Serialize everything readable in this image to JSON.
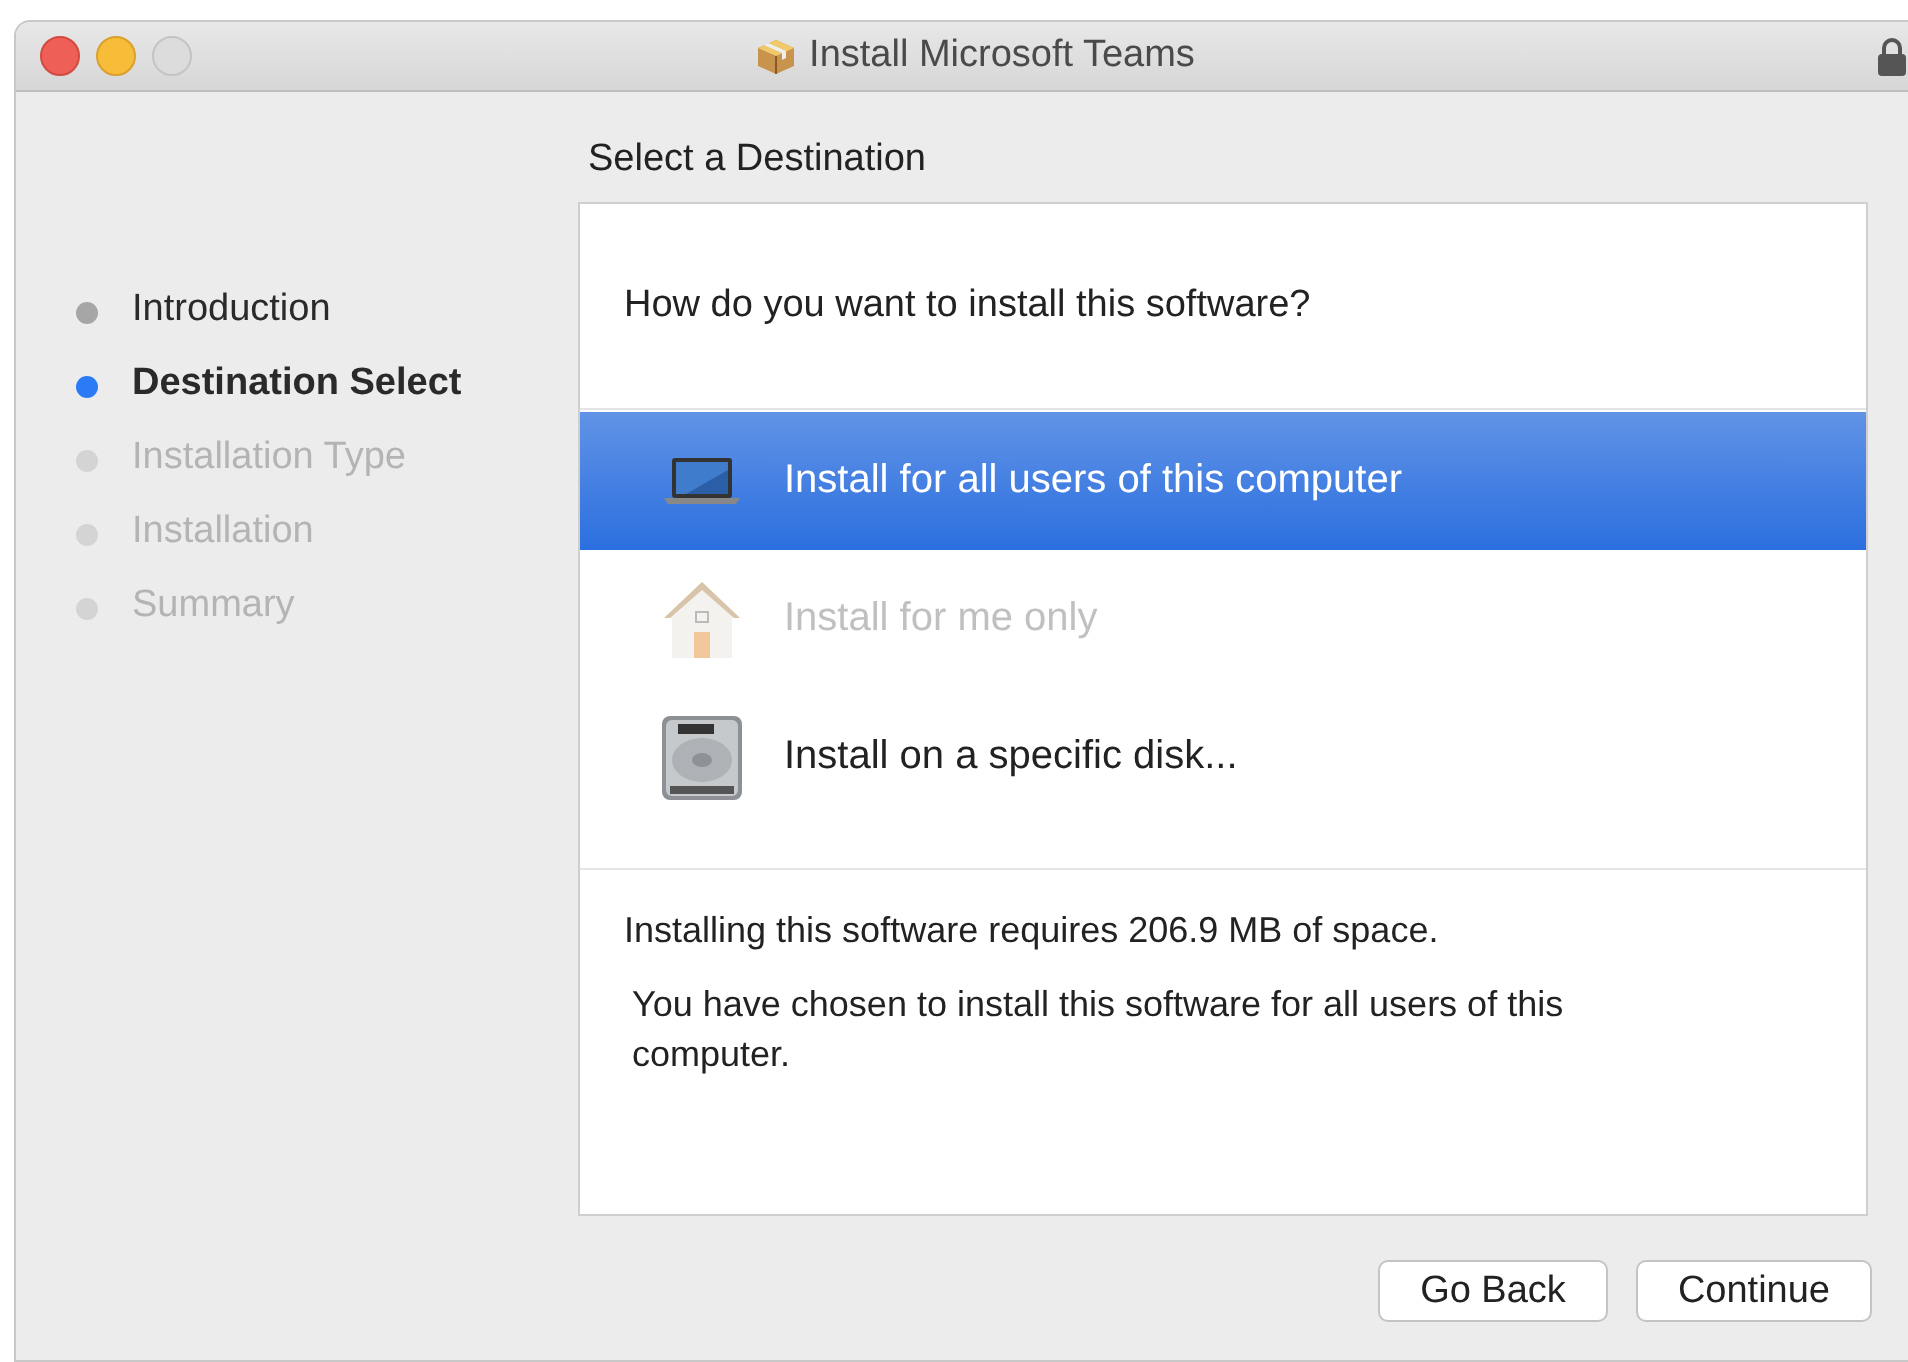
{
  "window": {
    "title": "Install Microsoft Teams"
  },
  "heading": "Select a Destination",
  "steps": [
    {
      "label": "Introduction",
      "disabled": false,
      "selected": false
    },
    {
      "label": "Destination Select",
      "disabled": false,
      "selected": true
    },
    {
      "label": "Installation Type",
      "disabled": true,
      "selected": false
    },
    {
      "label": "Installation",
      "disabled": true,
      "selected": false
    },
    {
      "label": "Summary",
      "disabled": true,
      "selected": false
    }
  ],
  "question": "How do you want to install this software?",
  "options": [
    {
      "label": "Install for all users of this computer",
      "kind": "laptop",
      "selected": true,
      "disabled": false
    },
    {
      "label": "Install for me only",
      "kind": "house",
      "selected": false,
      "disabled": true
    },
    {
      "label": "Install on a specific disk...",
      "kind": "disk",
      "selected": false,
      "disabled": false
    }
  ],
  "requirement": "Installing this software requires 206.9 MB of space.",
  "note": "You have chosen to install this software for all users of this computer.",
  "buttons": [
    "Go Back",
    "Continue"
  ]
}
